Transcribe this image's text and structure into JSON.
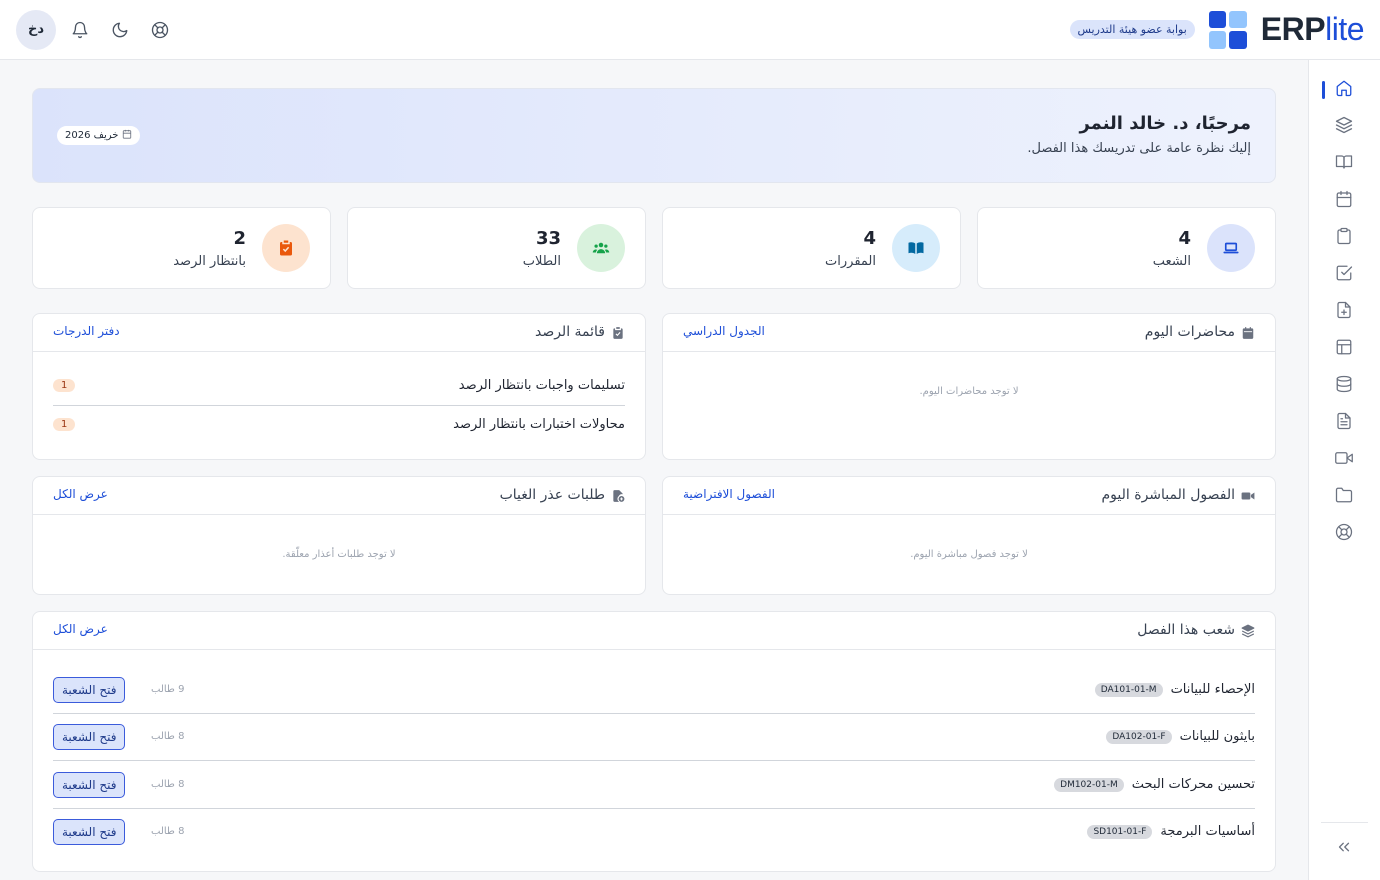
{
  "header": {
    "brand_bold": "ERP",
    "brand_light": "lite",
    "portal_badge": "بوابة عضو هيئة التدريس",
    "avatar_initials": "دخ"
  },
  "welcome": {
    "title": "مرحبًا، د. خالد النمر",
    "subtitle": "إليك نظرة عامة على تدريسك هذا الفصل.",
    "term": "خريف 2026"
  },
  "stats": [
    {
      "value": "4",
      "label": "الشعب",
      "icon": "laptop-icon",
      "bg": "#dbe3fb",
      "color": "#1d4ed8"
    },
    {
      "value": "4",
      "label": "المقررات",
      "icon": "book-open-icon",
      "bg": "#d6ecfb",
      "color": "#0369a1"
    },
    {
      "value": "33",
      "label": "الطلاب",
      "icon": "users-icon",
      "bg": "#d9f2dd",
      "color": "#16a34a"
    },
    {
      "value": "2",
      "label": "بانتظار الرصد",
      "icon": "clipboard-check-icon",
      "bg": "#fde3cf",
      "color": "#ea580c"
    }
  ],
  "today_lectures": {
    "title": "محاضرات اليوم",
    "link": "الجدول الدراسي",
    "empty": "لا توجد محاضرات اليوم."
  },
  "grading_queue": {
    "title": "قائمة الرصد",
    "link": "دفتر الدرجات",
    "items": [
      {
        "label": "تسليمات واجبات بانتظار الرصد",
        "count": "1"
      },
      {
        "label": "محاولات اختبارات بانتظار الرصد",
        "count": "1"
      }
    ]
  },
  "live_classes": {
    "title": "الفصول المباشرة اليوم",
    "link": "الفصول الافتراضية",
    "empty": "لا توجد فصول مباشرة اليوم."
  },
  "excuses": {
    "title": "طلبات عذر الغياب",
    "link": "عرض الكل",
    "empty": "لا توجد طلبات أعذار معلّقة."
  },
  "sections": {
    "title": "شعب هذا الفصل",
    "link": "عرض الكل",
    "open_label": "فتح الشعبة",
    "items": [
      {
        "name": "الإحصاء للبيانات",
        "code": "DA101-01-M",
        "count": "9 طالب"
      },
      {
        "name": "بايثون للبيانات",
        "code": "DA102-01-F",
        "count": "8 طالب"
      },
      {
        "name": "تحسين محركات البحث",
        "code": "DM102-01-M",
        "count": "8 طالب"
      },
      {
        "name": "أساسيات البرمجة",
        "code": "SD101-01-F",
        "count": "8 طالب"
      }
    ]
  },
  "sidebar": {
    "items": [
      "home-icon",
      "layers-icon",
      "book-icon",
      "calendar-icon",
      "clipboard-icon",
      "check-square-icon",
      "file-plus-icon",
      "layout-icon",
      "database-icon",
      "file-text-icon",
      "video-icon",
      "folder-icon",
      "lifebuoy-icon"
    ],
    "collapse_icon": "chevrons-left-icon"
  }
}
